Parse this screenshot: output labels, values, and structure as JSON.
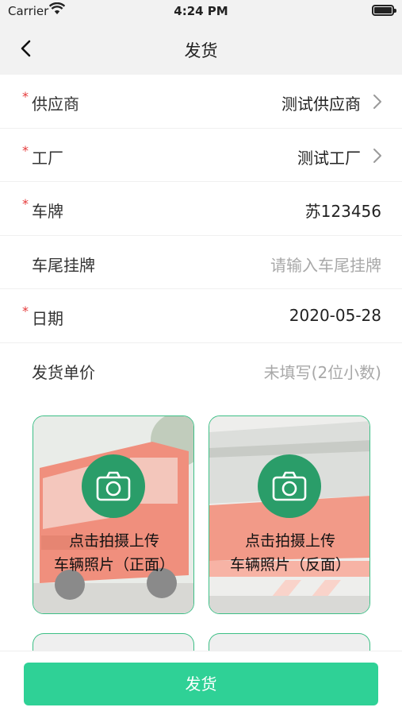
{
  "status_bar": {
    "carrier": "Carrier",
    "time": "4:24 PM"
  },
  "nav": {
    "title": "发货"
  },
  "form": {
    "rows": [
      {
        "label": "供应商",
        "value": "测试供应商"
      },
      {
        "label": "工厂",
        "value": "测试工厂"
      },
      {
        "label": "车牌",
        "value": "苏123456"
      },
      {
        "label": "车尾挂牌",
        "placeholder": "请输入车尾挂牌"
      },
      {
        "label": "日期",
        "value": "2020-05-28"
      },
      {
        "label": "发货单价",
        "placeholder": "未填写(2位小数)"
      }
    ]
  },
  "photos": [
    {
      "line1": "点击拍摄上传",
      "line2": "车辆照片（正面）"
    },
    {
      "line1": "点击拍摄上传",
      "line2": "车辆照片（反面）"
    }
  ],
  "bottom": {
    "submit_label": "发货"
  },
  "colors": {
    "accent": "#2fd196",
    "required": "#e5393a",
    "camera_bg": "#2a9d69"
  }
}
